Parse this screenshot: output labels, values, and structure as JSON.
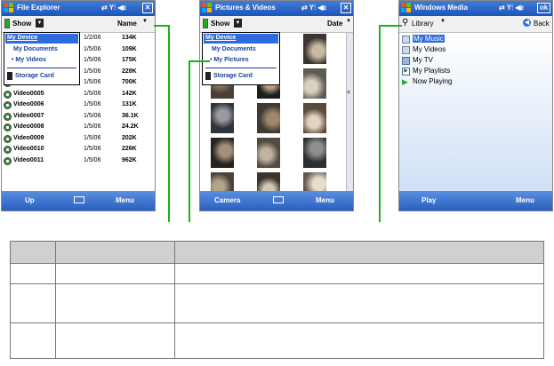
{
  "file_explorer": {
    "title": "File Explorer",
    "status_icons": "⇄ Y⫶ ◀ε",
    "close_label": "✕",
    "show_label": "Show",
    "sort_label": "Name",
    "show_menu": {
      "items": [
        "My Device",
        "My Documents",
        "• My Videos",
        "Storage Card"
      ]
    },
    "rows": [
      {
        "name": "",
        "date": "1/2/06",
        "size": "134K"
      },
      {
        "name": "",
        "date": "1/5/06",
        "size": "109K"
      },
      {
        "name": "",
        "date": "1/5/06",
        "size": "175K"
      },
      {
        "name": "",
        "date": "1/5/06",
        "size": "228K"
      },
      {
        "name": "Video0004",
        "date": "1/5/06",
        "size": "700K"
      },
      {
        "name": "Video0005",
        "date": "1/5/06",
        "size": "142K"
      },
      {
        "name": "Video0006",
        "date": "1/5/06",
        "size": "131K"
      },
      {
        "name": "Video0007",
        "date": "1/5/06",
        "size": "36.1K"
      },
      {
        "name": "Video0008",
        "date": "1/5/06",
        "size": "24.2K"
      },
      {
        "name": "Video0009",
        "date": "1/5/06",
        "size": "202K"
      },
      {
        "name": "Video0010",
        "date": "1/5/06",
        "size": "226K"
      },
      {
        "name": "Video0011",
        "date": "1/5/06",
        "size": "962K"
      }
    ],
    "soft_left": "Up",
    "soft_right": "Menu"
  },
  "pictures": {
    "title": "Pictures & Videos",
    "status_icons": "⇄ Y⫶ ◀ε",
    "close_label": "✕",
    "show_label": "Show",
    "sort_label": "Date",
    "show_menu": {
      "items": [
        "My Device",
        "My Documents",
        "• My Pictures",
        "Storage Card"
      ]
    },
    "soft_left": "Camera",
    "soft_right": "Menu"
  },
  "media": {
    "title": "Windows Media",
    "status_icons": "⇄ Y⫶ ◀ε",
    "ok_label": "ok",
    "library_label": "Library",
    "back_label": "Back",
    "items": [
      "My Music",
      "My Videos",
      "My TV",
      "My Playlists",
      "Now Playing"
    ],
    "soft_left": "Play",
    "soft_right": "Menu"
  },
  "colors": {
    "accent_green": "#1ab31a",
    "title_blue": "#2a62c8",
    "highlight_blue": "#2f6be0"
  }
}
